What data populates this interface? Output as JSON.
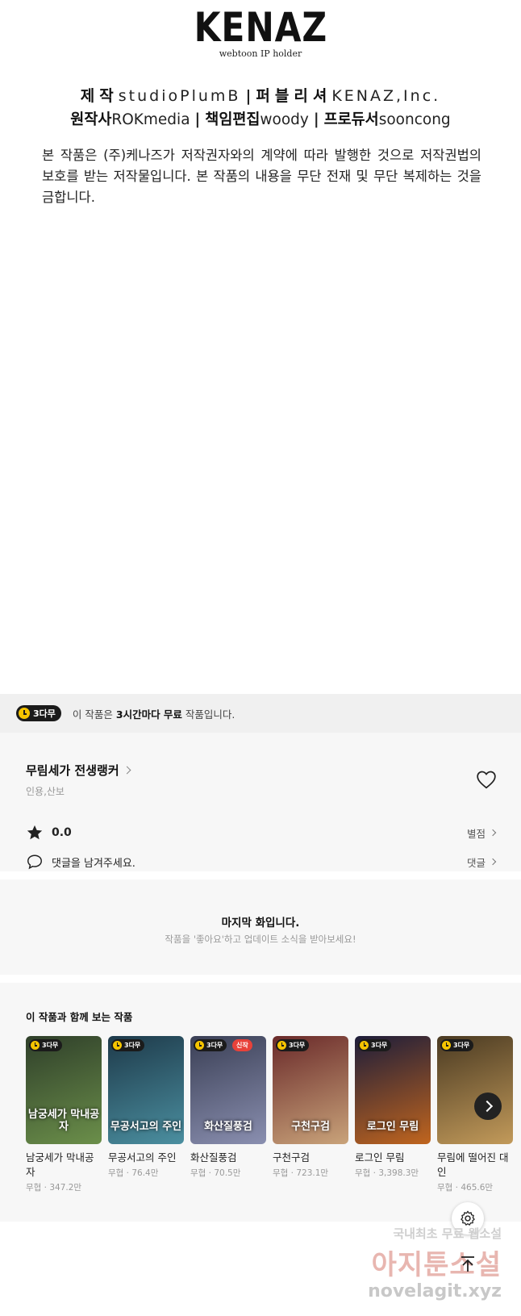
{
  "credits": {
    "logo": "KENAZ",
    "logo_sub": "webtoon IP holder",
    "line1": {
      "label1": "제작",
      "value1": "studioPlumB",
      "label2": "퍼블리셔",
      "value2": "KENAZ,Inc."
    },
    "line2": {
      "label1": "원작사",
      "value1": "ROKmedia",
      "label2": "책임편집",
      "value2": "woody",
      "label3": "프로듀서",
      "value3": "sooncong"
    },
    "separator": "|",
    "notice": "본 작품은 (주)케나즈가 저작권자와의 계약에 따라 발행한 것으로 저작권법의 보호를 받는 저작물입니다. 본 작품의 내용을 무단 전재 및 무단 복제하는 것을 금합니다."
  },
  "banner": {
    "badge": "3다무",
    "prefix": "이 작품은",
    "highlight": "3시간마다 무료",
    "suffix": "작품입니다."
  },
  "series": {
    "title": "무림세가 전생랭커",
    "author": "인용,산보",
    "rating": "0.0",
    "rating_link": "별점",
    "comment_placeholder": "댓글을 남겨주세요.",
    "comment_link": "댓글"
  },
  "end": {
    "title": "마지막 화입니다.",
    "subtitle": "작품을 '좋아요'하고 업데이트 소식을 받아보세요!"
  },
  "recommendations": {
    "title": "이 작품과 함께 보는 작품",
    "items": [
      {
        "title": "남궁세가 막내공자",
        "meta": "무협 · 347.2만",
        "badge": "3다무",
        "new": "",
        "cover": "남궁세가 막내공자",
        "color1": "#2f3f2a",
        "color2": "#6b8f4a"
      },
      {
        "title": "무공서고의 주인",
        "meta": "무협 · 76.4만",
        "badge": "3다무",
        "new": "",
        "cover": "무공서고의 주인",
        "color1": "#1e3a4a",
        "color2": "#4b8fa0"
      },
      {
        "title": "화산질풍검",
        "meta": "무협 · 70.5만",
        "badge": "3다무",
        "new": "신작",
        "cover": "화산질풍검",
        "color1": "#3a3f55",
        "color2": "#8a8fb0"
      },
      {
        "title": "구천구검",
        "meta": "무협 · 723.1만",
        "badge": "3다무",
        "new": "",
        "cover": "구천구검",
        "color1": "#6a2a2a",
        "color2": "#c9a37a"
      },
      {
        "title": "로그인 무림",
        "meta": "무협 · 3,398.3만",
        "badge": "3다무",
        "new": "",
        "cover": "로그인 무림",
        "color1": "#1d1d3a",
        "color2": "#c0651e"
      },
      {
        "title": "무림에 떨어진 대인",
        "meta": "무협 · 465.6만",
        "badge": "3다무",
        "new": "",
        "cover": "",
        "color1": "#4a3a22",
        "color2": "#c29a5a"
      }
    ]
  },
  "watermark": {
    "line1": "국내최초 무료 웹소설",
    "line2": "아지툰소설",
    "line3": "novelagit.xyz"
  },
  "colors": {
    "badge_bg": "#1b1b1b",
    "badge_clock": "#f5c400",
    "section_bg": "#f7f7f7",
    "banner_bg": "#f0f0f0",
    "new_tag": "#e8423a"
  }
}
